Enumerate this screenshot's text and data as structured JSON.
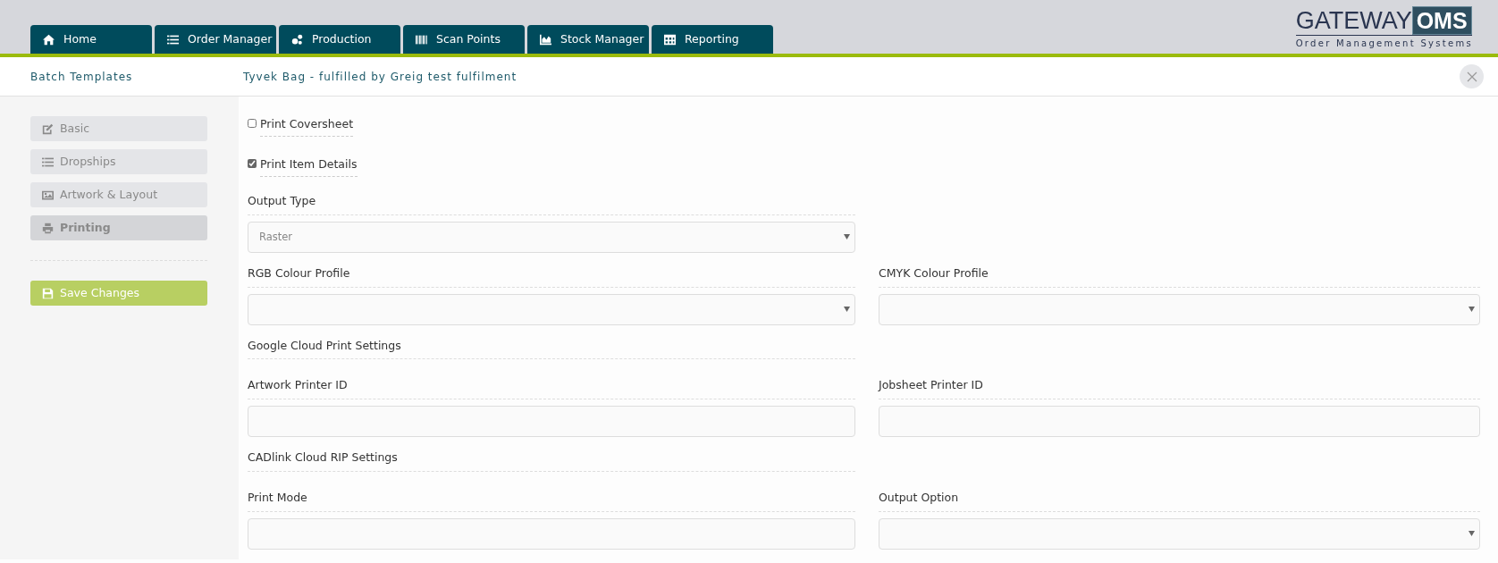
{
  "nav_tabs": [
    {
      "label": "Home"
    },
    {
      "label": "Order Manager"
    },
    {
      "label": "Production"
    },
    {
      "label": "Scan Points"
    },
    {
      "label": "Stock Manager"
    },
    {
      "label": "Reporting"
    }
  ],
  "logo": {
    "word": "GATEWAY",
    "badge": "OMS",
    "tagline": "Order Management Systems"
  },
  "section_title": "Batch Templates",
  "page_title": "Tyvek Bag - fulfilled by Greig test fulfilment",
  "sidebar": {
    "items": [
      {
        "label": "Basic",
        "selected": false
      },
      {
        "label": "Dropships",
        "selected": false
      },
      {
        "label": "Artwork & Layout",
        "selected": false
      },
      {
        "label": "Printing",
        "selected": true
      }
    ],
    "save_button": "Save Changes"
  },
  "form": [
    [
      {
        "kind": "checkbox",
        "label": "Print Coversheet",
        "checked": false
      }
    ],
    [
      {
        "kind": "checkbox",
        "label": "Print Item Details",
        "checked": true
      }
    ],
    [
      {
        "kind": "select",
        "label": "Output Type",
        "value": "Raster"
      }
    ],
    [
      {
        "kind": "select",
        "label": "RGB Colour Profile"
      },
      {
        "kind": "select",
        "label": "CMYK Colour Profile"
      }
    ],
    [
      {
        "kind": "heading",
        "label": "Google Cloud Print Settings"
      }
    ],
    [
      {
        "kind": "text",
        "label": "Artwork Printer ID"
      },
      {
        "kind": "text",
        "label": "Jobsheet Printer ID"
      }
    ],
    [
      {
        "kind": "heading",
        "label": "CADlink Cloud RIP Settings"
      }
    ],
    [
      {
        "kind": "text",
        "label": "Print Mode"
      },
      {
        "kind": "select",
        "label": "Output Option"
      }
    ]
  ]
}
